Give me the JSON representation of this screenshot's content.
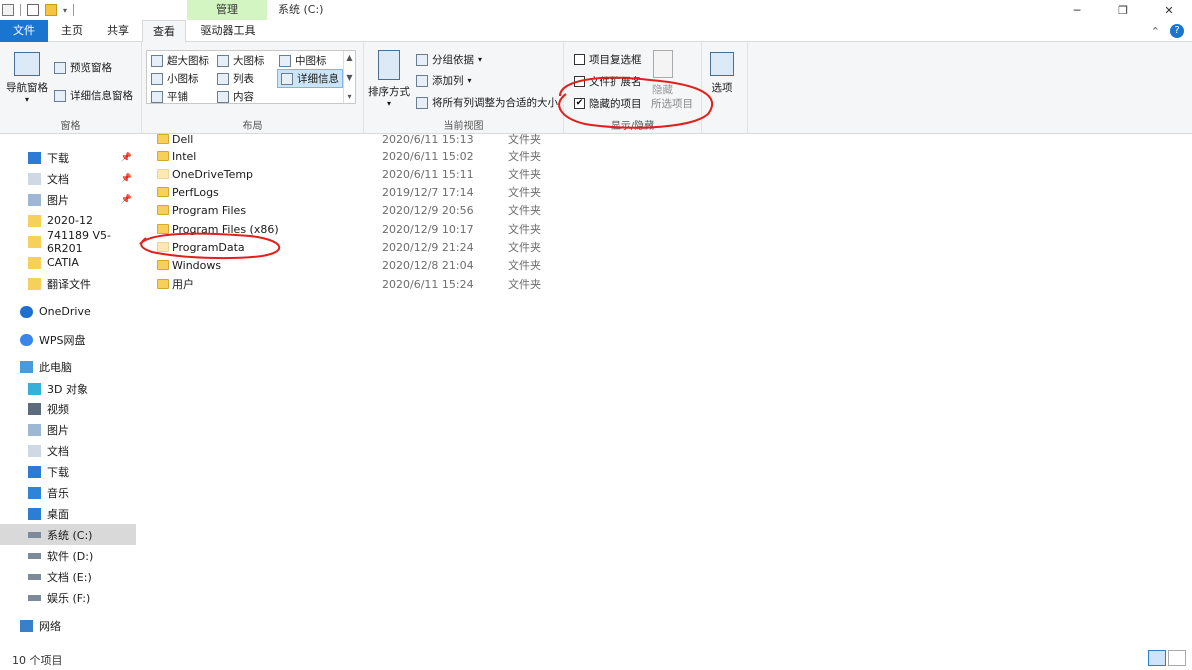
{
  "titlebar": {
    "manage_tab": "管理",
    "window_title": "系统 (C:)",
    "minimize": "─",
    "maximize": "❐",
    "close": "✕"
  },
  "ribbon_tabs": {
    "file": "文件",
    "home": "主页",
    "share": "共享",
    "view": "查看",
    "drive_tools": "驱动器工具",
    "collapse": "⌃",
    "help": "?"
  },
  "ribbon": {
    "panes": {
      "label": "窗格",
      "nav_pane": "导航窗格",
      "preview_pane": "预览窗格",
      "details_pane": "详细信息窗格"
    },
    "layout": {
      "label": "布局",
      "extra_large_icons": "超大图标",
      "large_icons": "大图标",
      "medium_icons": "中图标",
      "small_icons": "小图标",
      "list": "列表",
      "details": "详细信息",
      "tiles": "平铺",
      "content": "内容"
    },
    "current_view": {
      "label": "当前视图",
      "sort_by": "排序方式",
      "group_by": "分组依据",
      "add_columns": "添加列",
      "size_columns": "将所有列调整为合适的大小"
    },
    "show_hide": {
      "label": "显示/隐藏",
      "item_checkboxes": "项目复选框",
      "file_extensions": "文件扩展名",
      "hidden_items": "隐藏的项目",
      "hide": "隐藏",
      "selected_items": "所选项目",
      "hidden_items_checked": true
    },
    "options": {
      "label": "选项"
    }
  },
  "nav": {
    "items": [
      {
        "label": "下载",
        "icon": "download-icon",
        "pinned": true
      },
      {
        "label": "文档",
        "icon": "document-icon",
        "pinned": true
      },
      {
        "label": "图片",
        "icon": "picture-icon",
        "pinned": true
      },
      {
        "label": "2020-12",
        "icon": "folder-icon",
        "pinned": false
      },
      {
        "label": "741189 V5-6R201",
        "icon": "folder-icon",
        "pinned": false
      },
      {
        "label": "CATIA",
        "icon": "folder-icon",
        "pinned": false
      },
      {
        "label": "翻译文件",
        "icon": "folder-icon",
        "pinned": false
      },
      {
        "label": "OneDrive",
        "icon": "cloud-icon",
        "pinned": false
      },
      {
        "label": "WPS网盘",
        "icon": "wps-cloud-icon",
        "pinned": false
      },
      {
        "label": "此电脑",
        "icon": "computer-icon",
        "pinned": false
      },
      {
        "label": "3D 对象",
        "icon": "cube-icon",
        "pinned": false
      },
      {
        "label": "视频",
        "icon": "video-icon",
        "pinned": false
      },
      {
        "label": "图片",
        "icon": "picture-icon",
        "pinned": false
      },
      {
        "label": "文档",
        "icon": "document-icon",
        "pinned": false
      },
      {
        "label": "下载",
        "icon": "download-icon",
        "pinned": false
      },
      {
        "label": "音乐",
        "icon": "music-icon",
        "pinned": false
      },
      {
        "label": "桌面",
        "icon": "desktop-icon",
        "pinned": false
      },
      {
        "label": "系统 (C:)",
        "icon": "drive-icon",
        "pinned": false
      },
      {
        "label": "软件 (D:)",
        "icon": "drive-icon",
        "pinned": false
      },
      {
        "label": "文档 (E:)",
        "icon": "drive-icon",
        "pinned": false
      },
      {
        "label": "娱乐 (F:)",
        "icon": "drive-icon",
        "pinned": false
      },
      {
        "label": "网络",
        "icon": "network-icon",
        "pinned": false
      }
    ],
    "pin_glyph": "📌"
  },
  "files": {
    "rows": [
      {
        "name": "Dell",
        "date": "2020/6/11 15:13",
        "type": "文件夹",
        "hidden": false
      },
      {
        "name": "Intel",
        "date": "2020/6/11 15:02",
        "type": "文件夹",
        "hidden": false
      },
      {
        "name": "OneDriveTemp",
        "date": "2020/6/11 15:11",
        "type": "文件夹",
        "hidden": true
      },
      {
        "name": "PerfLogs",
        "date": "2019/12/7 17:14",
        "type": "文件夹",
        "hidden": false
      },
      {
        "name": "Program Files",
        "date": "2020/12/9 20:56",
        "type": "文件夹",
        "hidden": false
      },
      {
        "name": "Program Files (x86)",
        "date": "2020/12/9 10:17",
        "type": "文件夹",
        "hidden": false
      },
      {
        "name": "ProgramData",
        "date": "2020/12/9 21:24",
        "type": "文件夹",
        "hidden": true
      },
      {
        "name": "Windows",
        "date": "2020/12/8 21:04",
        "type": "文件夹",
        "hidden": false
      },
      {
        "name": "用户",
        "date": "2020/6/11 15:24",
        "type": "文件夹",
        "hidden": false
      }
    ]
  },
  "status": {
    "item_count": "10 个项目"
  },
  "colors": {
    "accent": "#1a75d1",
    "manage_tab": "#d2f5c1",
    "annotation_red": "#e0201c",
    "folder": "#f7cf5b"
  }
}
